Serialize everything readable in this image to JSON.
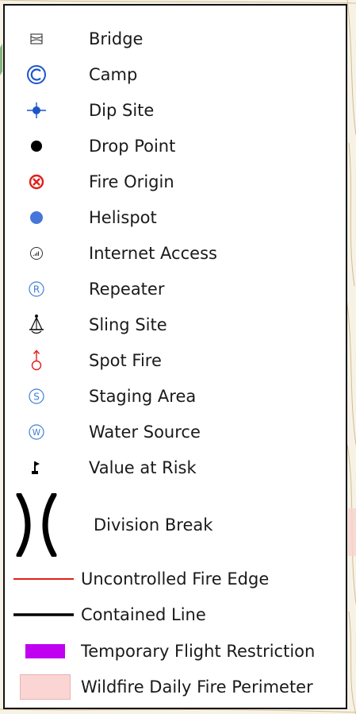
{
  "legend": {
    "items": [
      {
        "label": "Bridge",
        "icon": "bridge-icon"
      },
      {
        "label": "Camp",
        "icon": "camp-icon"
      },
      {
        "label": "Dip Site",
        "icon": "dip-site-icon"
      },
      {
        "label": "Drop Point",
        "icon": "drop-point-icon"
      },
      {
        "label": "Fire Origin",
        "icon": "fire-origin-icon"
      },
      {
        "label": "Helispot",
        "icon": "helispot-icon"
      },
      {
        "label": "Internet Access",
        "icon": "internet-access-icon"
      },
      {
        "label": "Repeater",
        "icon": "repeater-icon"
      },
      {
        "label": "Sling Site",
        "icon": "sling-site-icon"
      },
      {
        "label": "Spot Fire",
        "icon": "spot-fire-icon"
      },
      {
        "label": "Staging Area",
        "icon": "staging-area-icon"
      },
      {
        "label": "Water Source",
        "icon": "water-source-icon"
      },
      {
        "label": "Value at Risk",
        "icon": "value-at-risk-icon"
      },
      {
        "label": "Division Break",
        "icon": "division-break-icon"
      },
      {
        "label": "Uncontrolled Fire Edge",
        "icon": "uncontrolled-fire-edge-line",
        "color": "#e0201b"
      },
      {
        "label": "Contained Line",
        "icon": "contained-line",
        "color": "#000000"
      },
      {
        "label": "Temporary Flight Restriction",
        "icon": "tfr-swatch",
        "color": "#c000f0"
      },
      {
        "label": "Wildfire Daily Fire Perimeter",
        "icon": "perimeter-swatch",
        "color": "#fbd5d3"
      }
    ]
  },
  "colors": {
    "camp_blue": "#1c55c8",
    "circle_letter_blue": "#3e7fd6",
    "helispot_blue": "#4677d8",
    "fire_red": "#e0201b",
    "map_tan": "#f6f3e6",
    "contour": "#c9a77a"
  }
}
